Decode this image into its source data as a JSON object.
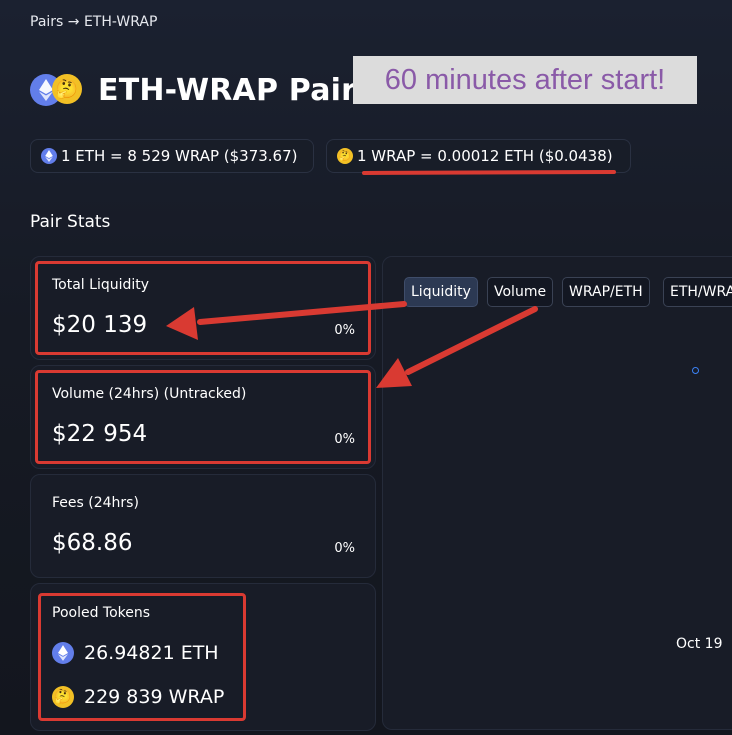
{
  "breadcrumb": "Pairs → ETH-WRAP",
  "page_title": "ETH-WRAP Pair",
  "overlay_note": "60 minutes after start!",
  "prices": {
    "eth_rate": "1 ETH = 8 529 WRAP ($373.67)",
    "wrap_rate": "1 WRAP = 0.00012 ETH ($0.0438)"
  },
  "section_title": "Pair Stats",
  "stats": {
    "total_liquidity": {
      "label": "Total Liquidity",
      "value": "$20 139",
      "change": "0%"
    },
    "volume": {
      "label": "Volume (24hrs) (Untracked)",
      "value": "$22 954",
      "change": "0%"
    },
    "fees": {
      "label": "Fees (24hrs)",
      "value": "$68.86",
      "change": "0%"
    }
  },
  "pooled": {
    "label": "Pooled Tokens",
    "eth": "26.94821 ETH",
    "wrap": "229 839 WRAP"
  },
  "chart": {
    "tabs": [
      "Liquidity",
      "Volume",
      "WRAP/ETH",
      "ETH/WRAP"
    ],
    "active_tab": "Liquidity",
    "x_tick": "Oct 19"
  },
  "icons": {
    "eth": "ethereum-icon",
    "wrap": "thinking-face-emoji-icon"
  },
  "colors": {
    "eth_blue": "#627eea",
    "annotation_red": "#d93a32",
    "overlay_text": "#8a5aa8"
  }
}
